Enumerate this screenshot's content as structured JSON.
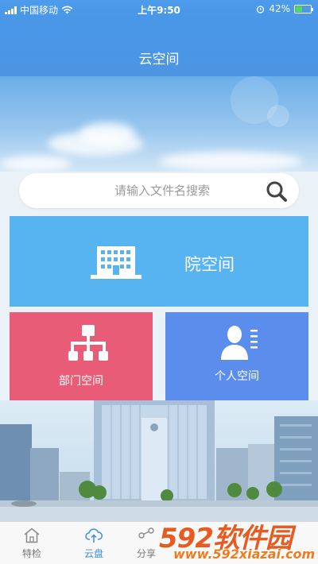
{
  "status_bar": {
    "carrier": "中国移动",
    "time": "上午9:50",
    "battery": "42%",
    "battery_level": 0.42
  },
  "nav": {
    "title": "云空间"
  },
  "search": {
    "placeholder": "请输入文件名搜索",
    "value": ""
  },
  "tiles": {
    "hospital": {
      "label": "院空间",
      "color": "#58b4f1"
    },
    "department": {
      "label": "部门空间",
      "color": "#e85c78"
    },
    "personal": {
      "label": "个人空间",
      "color": "#5b8ded"
    }
  },
  "tabs": [
    {
      "label": "特检",
      "icon": "home-icon",
      "active": false
    },
    {
      "label": "云盘",
      "icon": "cloud-upload-icon",
      "active": true
    },
    {
      "label": "分享",
      "icon": "share-icon",
      "active": false
    }
  ],
  "watermark": {
    "logo": "592软件园",
    "url": "www.592xiazai.com"
  },
  "colors": {
    "accent": "#3b8fe0",
    "nav_bg": "#4a97e8"
  }
}
